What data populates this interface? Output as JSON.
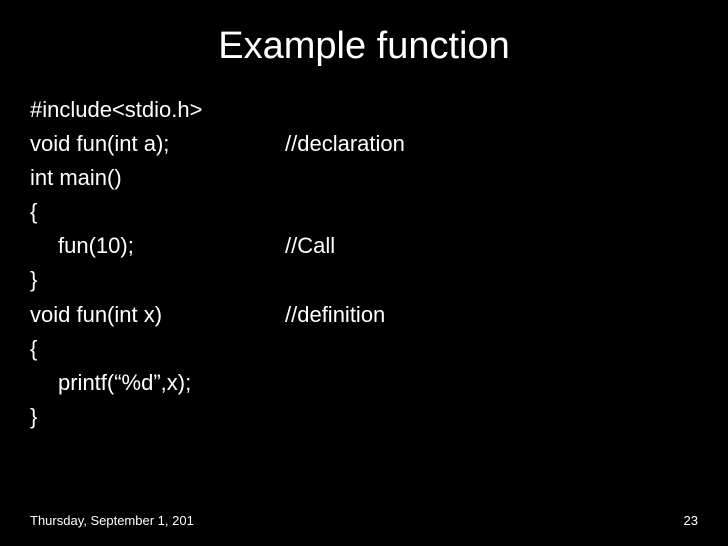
{
  "title": "Example function",
  "code": {
    "line1": "#include<stdio.h>",
    "line2_left": "void fun(int a);",
    "line2_right": "//declaration",
    "line3": "int main()",
    "line4": "{",
    "line5_left": "fun(10);",
    "line5_right": "//Call",
    "line6": "}",
    "line7_left": "void fun(int x)",
    "line7_right": "//definition",
    "line8": "{",
    "line9": "printf(“%d”,x);",
    "line10": "}"
  },
  "footer": {
    "date": "Thursday, September 1, 201",
    "page": "23"
  }
}
